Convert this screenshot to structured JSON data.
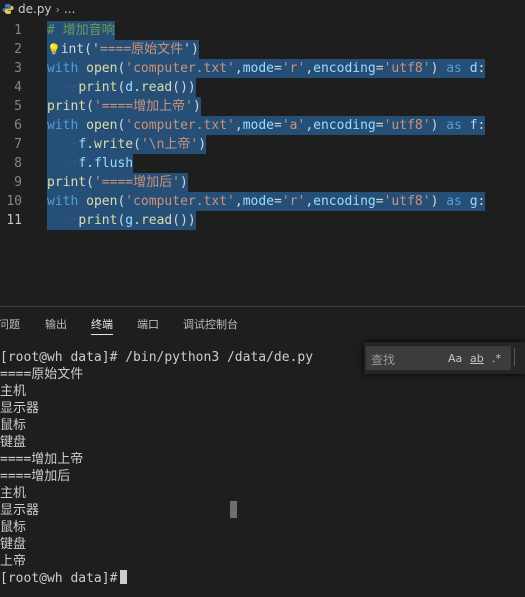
{
  "breadcrumb": {
    "file": "de.py",
    "separator": "›",
    "more": "..."
  },
  "editor": {
    "lines": [
      {
        "num": "1",
        "parts": [
          [
            "cm",
            "# 增加音响"
          ]
        ]
      },
      {
        "num": "2",
        "parts": [
          [
            "pl",
            "int('"
          ],
          [
            "str",
            "====原始文件"
          ],
          [
            "pl",
            "')"
          ]
        ]
      },
      {
        "num": "3",
        "parts": [
          [
            "kw",
            "with "
          ],
          [
            "fn",
            "open"
          ],
          [
            "pl",
            "("
          ],
          [
            "str",
            "'computer.txt'"
          ],
          [
            "pl",
            ","
          ],
          [
            "var",
            "mode"
          ],
          [
            "pl",
            "="
          ],
          [
            "str",
            "'r'"
          ],
          [
            "pl",
            ","
          ],
          [
            "var",
            "encoding"
          ],
          [
            "pl",
            "="
          ],
          [
            "str",
            "'utf8'"
          ],
          [
            "pl",
            ") "
          ],
          [
            "kw",
            "as "
          ],
          [
            "var",
            "d"
          ],
          [
            "pl",
            ":"
          ]
        ]
      },
      {
        "num": "4",
        "parts": [
          [
            "ws",
            "····"
          ],
          [
            "fn",
            "print"
          ],
          [
            "pl",
            "("
          ],
          [
            "var",
            "d"
          ],
          [
            "pl",
            "."
          ],
          [
            "fn",
            "read"
          ],
          [
            "pl",
            "())"
          ]
        ]
      },
      {
        "num": "5",
        "parts": [
          [
            "fn",
            "print"
          ],
          [
            "pl",
            "("
          ],
          [
            "str",
            "'====增加上帝'"
          ],
          [
            "pl",
            ")"
          ]
        ]
      },
      {
        "num": "6",
        "parts": [
          [
            "kw",
            "with "
          ],
          [
            "fn",
            "open"
          ],
          [
            "pl",
            "("
          ],
          [
            "str",
            "'computer.txt'"
          ],
          [
            "pl",
            ","
          ],
          [
            "var",
            "mode"
          ],
          [
            "pl",
            "="
          ],
          [
            "str",
            "'a'"
          ],
          [
            "pl",
            ","
          ],
          [
            "var",
            "encoding"
          ],
          [
            "pl",
            "="
          ],
          [
            "str",
            "'utf8'"
          ],
          [
            "pl",
            ") "
          ],
          [
            "kw",
            "as "
          ],
          [
            "var",
            "f"
          ],
          [
            "pl",
            ":"
          ]
        ]
      },
      {
        "num": "7",
        "parts": [
          [
            "ws",
            "····"
          ],
          [
            "var",
            "f"
          ],
          [
            "pl",
            "."
          ],
          [
            "fn",
            "write"
          ],
          [
            "pl",
            "("
          ],
          [
            "str",
            "'\\n上帝'"
          ],
          [
            "pl",
            ")"
          ]
        ]
      },
      {
        "num": "8",
        "parts": [
          [
            "ws",
            "····"
          ],
          [
            "var",
            "f"
          ],
          [
            "pl",
            "."
          ],
          [
            "var",
            "flush"
          ]
        ]
      },
      {
        "num": "9",
        "parts": [
          [
            "fn",
            "print"
          ],
          [
            "pl",
            "("
          ],
          [
            "str",
            "'====增加后'"
          ],
          [
            "pl",
            ")"
          ]
        ]
      },
      {
        "num": "10",
        "parts": [
          [
            "kw",
            "with "
          ],
          [
            "fn",
            "open"
          ],
          [
            "pl",
            "("
          ],
          [
            "str",
            "'computer.txt'"
          ],
          [
            "pl",
            ","
          ],
          [
            "var",
            "mode"
          ],
          [
            "pl",
            "="
          ],
          [
            "str",
            "'r'"
          ],
          [
            "pl",
            ","
          ],
          [
            "var",
            "encoding"
          ],
          [
            "pl",
            "="
          ],
          [
            "str",
            "'utf8'"
          ],
          [
            "pl",
            ") "
          ],
          [
            "kw",
            "as "
          ],
          [
            "var",
            "g"
          ],
          [
            "pl",
            ":"
          ]
        ]
      },
      {
        "num": "11",
        "parts": [
          [
            "ws",
            "····"
          ],
          [
            "fn",
            "print"
          ],
          [
            "pl",
            "("
          ],
          [
            "var",
            "g"
          ],
          [
            "pl",
            "."
          ],
          [
            "fn",
            "read"
          ],
          [
            "pl",
            "())"
          ]
        ]
      }
    ],
    "active_line": "11"
  },
  "panel": {
    "tabs": [
      "问题",
      "输出",
      "终端",
      "端口",
      "调试控制台"
    ],
    "active_tab": "终端"
  },
  "terminal": {
    "lines": [
      "[root@wh data]# /bin/python3 /data/de.py",
      "====原始文件",
      "主机",
      "显示器",
      "鼠标",
      "键盘",
      "====增加上帝",
      "====增加后",
      "主机",
      "显示器",
      "鼠标",
      "键盘",
      "上帝",
      "[root@wh data]#"
    ]
  },
  "find": {
    "placeholder": "查找",
    "match_case": "Aa",
    "whole_word": "ab",
    "regex": ".*"
  }
}
